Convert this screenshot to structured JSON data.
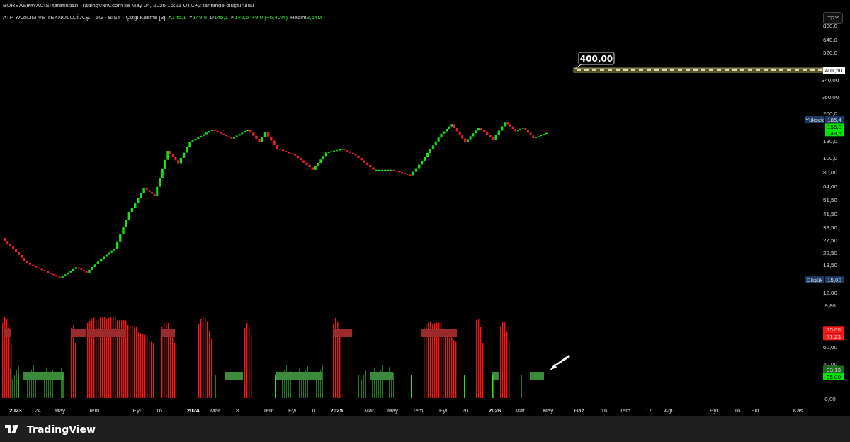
{
  "attribution": "BORSASIMYACISI tarafından TradingView.com ile May 04, 2026 16:21 UTC+3 tarihinde oluşturuldu",
  "legend": {
    "symbol": "ATP YAZILIM VE TEKNOLOJİ A.Ş. · 1G · BIST · Çizgi Kesme [3]",
    "fields": [
      {
        "label": "A",
        "value": "145,1"
      },
      {
        "label": "Y",
        "value": "149,6"
      },
      {
        "label": "D",
        "value": "145,1"
      },
      {
        "label": "K",
        "value": "149,6"
      },
      {
        "value": "+9,0 (+6,40%)"
      },
      {
        "label": "Hacim",
        "value": "3,64M"
      }
    ]
  },
  "currency_button": "TRY",
  "price_pane": {
    "axis": {
      "xticks": [
        {
          "label": "2023",
          "major": true
        },
        {
          "label": "24",
          "major": false
        },
        {
          "label": "May",
          "major": false
        },
        {
          "label": "Tem",
          "major": false
        },
        {
          "label": "Eyl",
          "major": false
        },
        {
          "label": "16",
          "major": false
        },
        {
          "label": "2024",
          "major": true
        },
        {
          "label": "Mar",
          "major": false
        },
        {
          "label": "8",
          "major": false
        },
        {
          "label": "Tem",
          "major": false
        },
        {
          "label": "Eyl",
          "major": false
        },
        {
          "label": "10",
          "major": false
        },
        {
          "label": "2025",
          "major": true
        },
        {
          "label": "Mar",
          "major": false
        },
        {
          "label": "May",
          "major": false
        },
        {
          "label": "Tem",
          "major": false
        },
        {
          "label": "Eyl",
          "major": false
        },
        {
          "label": "20",
          "major": false
        },
        {
          "label": "2026",
          "major": true
        },
        {
          "label": "Mar",
          "major": false
        },
        {
          "label": "May",
          "major": false
        },
        {
          "label": "Haz",
          "major": false
        },
        {
          "label": "16",
          "major": false
        },
        {
          "label": "Tem",
          "major": false
        },
        {
          "label": "17",
          "major": false
        },
        {
          "label": "Ağu",
          "major": false
        },
        {
          "label": "Eyl",
          "major": false
        },
        {
          "label": "16",
          "major": false
        },
        {
          "label": "Eki",
          "major": false
        },
        {
          "label": "Kas",
          "major": false
        }
      ],
      "yticks": [
        "800,0",
        "640,0",
        "520,0",
        "340,00",
        "260,00",
        "200,0",
        "130,0",
        "100,0",
        "80,00",
        "64,00",
        "51,50",
        "41,50",
        "33,50",
        "27,50",
        "22,50",
        "18,50",
        "12,00",
        "9,80"
      ]
    },
    "horizontal_line": {
      "label": "400,00",
      "price": "401,50"
    },
    "badges": [
      {
        "tag": "Yüksek",
        "text": "185,4",
        "color": "#1e3a66"
      },
      {
        "text": "156,0",
        "color": "#00e600"
      },
      {
        "text": "149,6",
        "color": "#00e600"
      },
      {
        "tag": "Düşük",
        "text": "15,00",
        "color": "#1e3a66"
      }
    ]
  },
  "indicator_pane": {
    "yticks": [
      "60,00",
      "40,00",
      "0,00"
    ],
    "badges": [
      {
        "text": "75,00",
        "color": "#ff1a1a"
      },
      {
        "text": "71,23",
        "color": "#ff1a1a"
      },
      {
        "text": "33,13",
        "color": "#1b6e1b"
      },
      {
        "text": "25,00",
        "color": "#00e600"
      }
    ]
  },
  "brand": "TradingView"
}
